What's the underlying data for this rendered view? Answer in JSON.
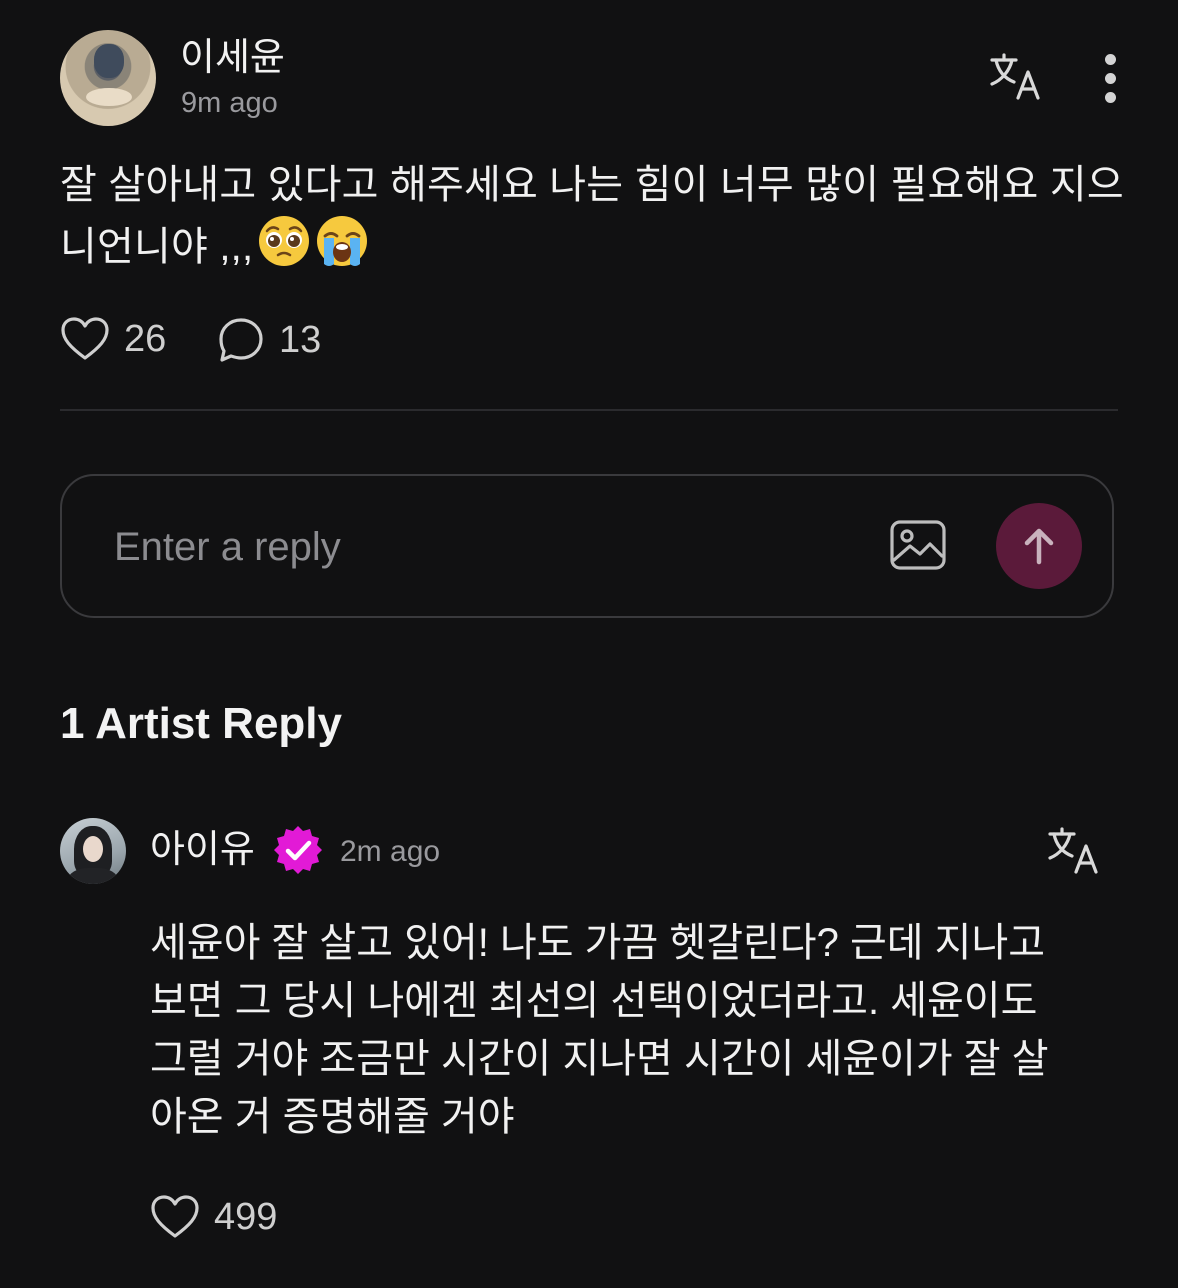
{
  "post": {
    "author": "이세윤",
    "time": "9m ago",
    "text": "잘 살아내고 있다고 해주세요 나는 힘이 너무 많이 필요해요 지으니언니야 ,,,",
    "emojis": [
      "pleading-face-emoji",
      "loudly-crying-face-emoji"
    ],
    "likes": "26",
    "comments": "13"
  },
  "reply_box": {
    "placeholder": "Enter a reply"
  },
  "artist_replies": {
    "title": "1 Artist Reply",
    "items": [
      {
        "name": "아이유",
        "verified": true,
        "time": "2m ago",
        "text": "세윤아 잘 살고 있어! 나도 가끔 헷갈린다? 근데 지나고\n보면 그 당시 나에겐 최선의 선택이었더라고. 세윤이도\n그럴 거야  조금만 시간이 지나면 시간이 세윤이가 잘 살\n아온 거 증명해줄 거야",
        "likes": "499"
      }
    ]
  },
  "colors": {
    "background": "#111112",
    "send_button": "#5b1a3a",
    "verified_badge": "#e21ad6"
  },
  "icons": [
    "translate-icon",
    "more-vertical-icon",
    "heart-icon",
    "comment-icon",
    "image-icon",
    "arrow-up-icon",
    "verified-icon"
  ]
}
